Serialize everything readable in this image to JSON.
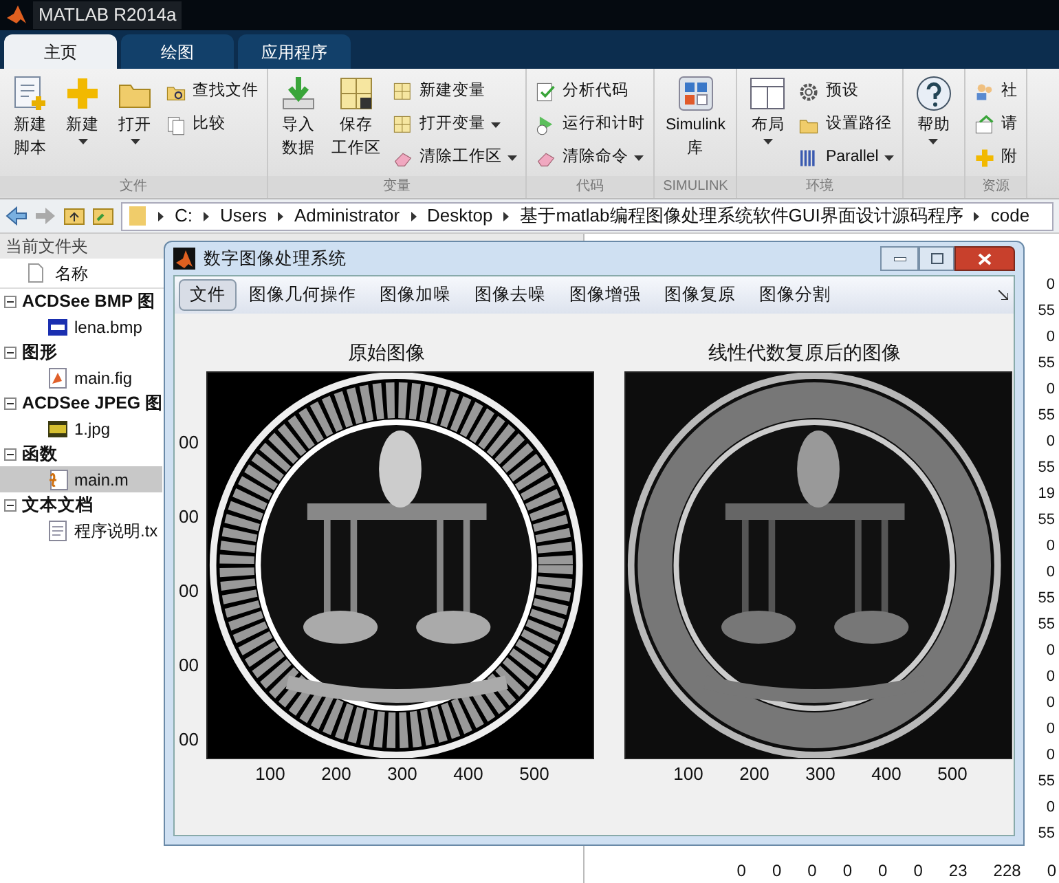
{
  "window": {
    "title": "MATLAB R2014a"
  },
  "tabs": [
    {
      "label": "主页",
      "selected": true
    },
    {
      "label": "绘图",
      "selected": false
    },
    {
      "label": "应用程序",
      "selected": false
    }
  ],
  "ribbon": [
    {
      "title": "文件",
      "large": [
        {
          "lines": [
            "新建",
            "脚本"
          ],
          "dropdown": false
        },
        {
          "lines": [
            "新建"
          ],
          "dropdown": true
        },
        {
          "lines": [
            "打开"
          ],
          "dropdown": true
        }
      ],
      "small": [
        {
          "label": "查找文件",
          "dropdown": false
        },
        {
          "label": "比较",
          "dropdown": false
        }
      ]
    },
    {
      "title": "变量",
      "large": [
        {
          "lines": [
            "导入",
            "数据"
          ],
          "dropdown": false
        },
        {
          "lines": [
            "保存",
            "工作区"
          ],
          "dropdown": false
        }
      ],
      "small": [
        {
          "label": "新建变量",
          "dropdown": false
        },
        {
          "label": "打开变量",
          "dropdown": true
        },
        {
          "label": "清除工作区",
          "dropdown": true
        }
      ]
    },
    {
      "title": "代码",
      "small": [
        {
          "label": "分析代码",
          "dropdown": false
        },
        {
          "label": "运行和计时",
          "dropdown": false
        },
        {
          "label": "清除命令",
          "dropdown": true
        }
      ]
    },
    {
      "title": "SIMULINK",
      "large": [
        {
          "lines": [
            "Simulink",
            "库"
          ],
          "dropdown": false
        }
      ]
    },
    {
      "title": "环境",
      "large": [
        {
          "lines": [
            "布局"
          ],
          "dropdown": true
        }
      ],
      "small": [
        {
          "label": "预设",
          "dropdown": false
        },
        {
          "label": "设置路径",
          "dropdown": false
        },
        {
          "label": "Parallel",
          "dropdown": true
        }
      ]
    },
    {
      "large": [
        {
          "lines": [
            "帮助"
          ],
          "dropdown": true
        }
      ]
    },
    {
      "title": "资源",
      "small": [
        {
          "label": "社",
          "dropdown": false
        },
        {
          "label": "请",
          "dropdown": false
        },
        {
          "label": "附",
          "dropdown": false
        }
      ]
    }
  ],
  "address_bar": {
    "path": [
      "C:",
      "Users",
      "Administrator",
      "Desktop",
      "基于matlab编程图像处理系统软件GUI界面设计源码程序",
      "code"
    ]
  },
  "current_folder": {
    "title": "当前文件夹",
    "column": "名称",
    "groups": [
      {
        "label": "ACDSee BMP 图",
        "expanded": true,
        "children": [
          {
            "name": "lena.bmp",
            "selected": false
          }
        ]
      },
      {
        "label": "图形",
        "expanded": true,
        "children": [
          {
            "name": "main.fig",
            "selected": false
          }
        ]
      },
      {
        "label": "ACDSee JPEG 图",
        "expanded": true,
        "children": [
          {
            "name": "1.jpg",
            "selected": false
          }
        ]
      },
      {
        "label": "函数",
        "expanded": true,
        "children": [
          {
            "name": "main.m",
            "selected": true
          }
        ]
      },
      {
        "label": "文本文档",
        "expanded": true,
        "children": [
          {
            "name": "程序说明.tx",
            "selected": false
          }
        ]
      }
    ]
  },
  "command_window": {
    "right_column": [
      "0",
      "55",
      "0",
      "55",
      "0",
      "55",
      "0",
      "55",
      "19",
      "55",
      "0",
      "0",
      "55",
      "55",
      "0",
      "0",
      "0",
      "0",
      "0",
      "55",
      "0",
      "55"
    ],
    "bottom_row": [
      "0",
      "0",
      "0",
      "0",
      "0",
      "0",
      "23",
      "228",
      "0"
    ]
  },
  "figure": {
    "title": "数字图像处理系统",
    "menu": [
      {
        "label": "文件",
        "selected": true
      },
      {
        "label": "图像几何操作",
        "selected": false
      },
      {
        "label": "图像加噪",
        "selected": false
      },
      {
        "label": "图像去噪",
        "selected": false
      },
      {
        "label": "图像增强",
        "selected": false
      },
      {
        "label": "图像复原",
        "selected": false
      },
      {
        "label": "图像分割",
        "selected": false
      }
    ],
    "axes": [
      {
        "title": "原始图像",
        "blurred": false,
        "yticks": [
          "00",
          "00",
          "00",
          "00",
          "00"
        ],
        "xticks": [
          "100",
          "200",
          "300",
          "400",
          "500"
        ]
      },
      {
        "title": "线性代数复原后的图像",
        "blurred": true,
        "xticks": [
          "100",
          "200",
          "300",
          "400",
          "500"
        ]
      }
    ]
  }
}
